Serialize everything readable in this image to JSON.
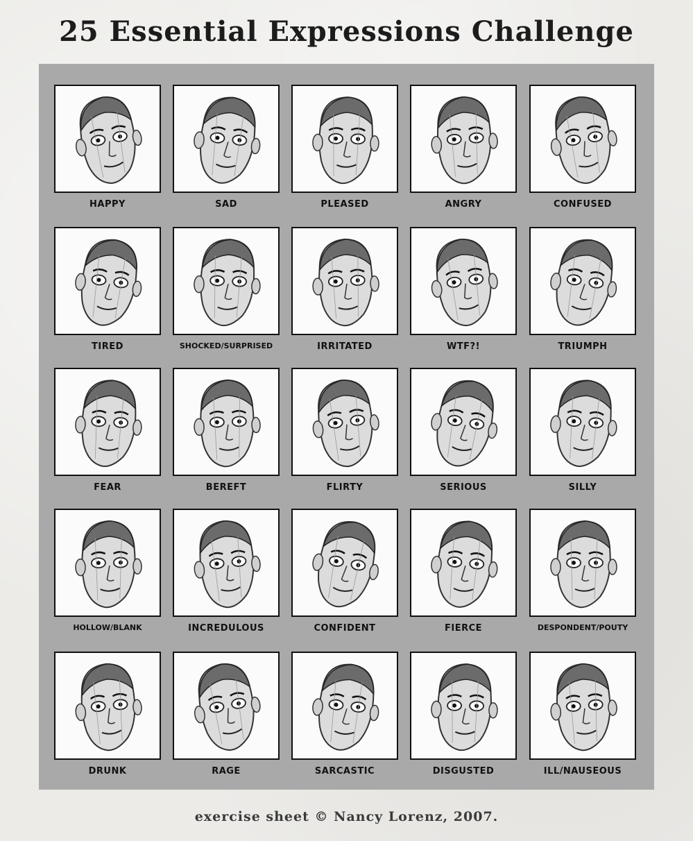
{
  "title": "25 Essential Expressions Challenge",
  "footer": "exercise sheet © Nancy Lorenz, 2007.",
  "expressions": [
    "HAPPY",
    "SAD",
    "PLEASED",
    "ANGRY",
    "CONFUSED",
    "TIRED",
    "SHOCKED/SURPRISED",
    "IRRITATED",
    "WTF?!",
    "TRIUMPH",
    "FEAR",
    "BEREFT",
    "FLIRTY",
    "SERIOUS",
    "SILLY",
    "HOLLOW/BLANK",
    "INCREDULOUS",
    "CONFIDENT",
    "FIERCE",
    "DESPONDENT/POUTY",
    "DRUNK",
    "RAGE",
    "SARCASTIC",
    "DISGUSTED",
    "ILL/NAUSEOUS"
  ]
}
